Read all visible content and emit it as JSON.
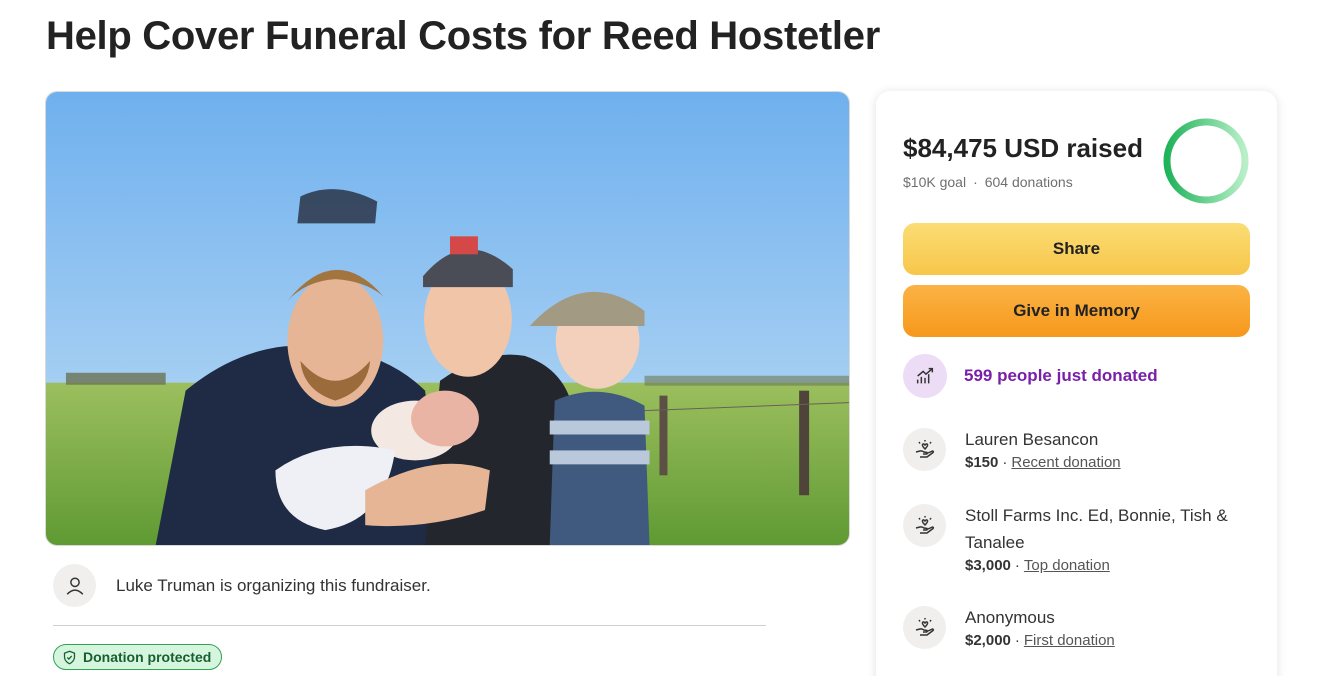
{
  "page": {
    "title": "Help Cover Funeral Costs for Reed Hostetler"
  },
  "organizer": {
    "text": "Luke Truman is organizing this fundraiser.",
    "icon": "person-icon"
  },
  "badge": {
    "label": "Donation protected",
    "icon": "shield-icon"
  },
  "stats": {
    "raised_amount": "$84,475 USD",
    "raised_suffix": "raised",
    "goal": "$10K goal",
    "separator": "·",
    "donations": "604 donations",
    "progress_fraction": 1.0
  },
  "actions": {
    "share_label": "Share",
    "give_label": "Give in Memory"
  },
  "activity": {
    "text": "599 people just donated",
    "icon": "trending-up-icon"
  },
  "donors": [
    {
      "name": "Lauren Besancon",
      "amount": "$150",
      "tag": "Recent donation",
      "icon": "heart-hand-icon"
    },
    {
      "name": "Stoll Farms Inc. Ed, Bonnie, Tish & Tanalee",
      "amount": "$3,000",
      "tag": "Top donation",
      "icon": "heart-hand-icon"
    },
    {
      "name": "Anonymous",
      "amount": "$2,000",
      "tag": "First donation",
      "icon": "heart-hand-icon"
    }
  ],
  "colors": {
    "progress_green": "#1fb35a",
    "progress_light": "#9be3b1",
    "share_button": "#f7c64a",
    "give_button": "#f6981c",
    "activity_purple": "#7a1fa8",
    "badge_green": "#d6f5de"
  }
}
